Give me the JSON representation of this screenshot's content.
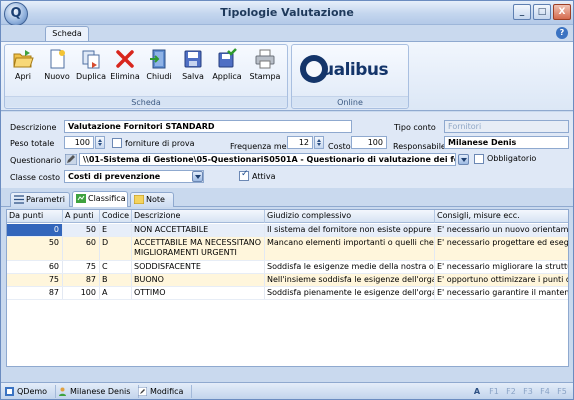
{
  "window": {
    "title": "Tipologie Valutazione",
    "minimize": "_",
    "maximize": "□",
    "close": "X"
  },
  "ribbon": {
    "tab": "Scheda",
    "help": "?",
    "groups": {
      "scheda": "Scheda",
      "online": "Online"
    },
    "buttons": [
      "Apri",
      "Nuovo",
      "Duplica",
      "Elimina",
      "Chiudi",
      "Salva",
      "Applica",
      "Stampa"
    ],
    "logo_text": "ualibus"
  },
  "form": {
    "descrizione_label": "Descrizione",
    "descrizione_value": "Valutazione Fornitori STANDARD",
    "tipo_conto_label": "Tipo conto",
    "tipo_conto_value": "Fornitori",
    "peso_totale_label": "Peso totale",
    "peso_totale_value": "100",
    "forniture_prova_label": "forniture di prova",
    "frequenza_label": "Frequenza mesi",
    "frequenza_value": "12",
    "costo_label": "Costo",
    "costo_value": "100",
    "responsabile_label": "Responsabile",
    "responsabile_value": "Milanese Denis",
    "questionario_label": "Questionario",
    "questionario_value": "\\\\01-Sistema di Gestione\\05-QuestionariS0501A - Questionario di valutazione dei fornit",
    "obbligatorio_label": "Obbligatorio",
    "classe_costo_label": "Classe costo",
    "classe_costo_value": "Costi di prevenzione",
    "attiva_label": "Attiva"
  },
  "tabs": [
    "Parametri",
    "Classifica",
    "Note"
  ],
  "grid": {
    "columns": [
      "Da punti",
      "A punti",
      "Codice",
      "Descrizione",
      "Giudizio complessivo",
      "Consigli, misure ecc."
    ],
    "rows": [
      [
        "0",
        "50",
        "E",
        "NON ACCETTABILE",
        "Il sistema del fornitore non esiste oppure è carat",
        "E' necessario un nuovo orientamento"
      ],
      [
        "50",
        "60",
        "D",
        "ACCETTABILE MA NECESSITANO MIGLIORAMENTI URGENTI",
        "Mancano elementi importanti o quelli che ci sono",
        "E' necessario progettare ed eseguire"
      ],
      [
        "60",
        "75",
        "C",
        "SODDISFACENTE",
        "Soddisfa le esigenze medie della nostra organizza",
        "E' necessario migliorare la struttura de"
      ],
      [
        "75",
        "87",
        "B",
        "BUONO",
        "Nell'insieme soddisfa le esigenze dell'organizzazi",
        "E' opportuno ottimizzare i punti debol"
      ],
      [
        "87",
        "100",
        "A",
        "OTTIMO",
        "Soddisfa pienamente le esigenze dell'organizza",
        "E' necessario garantire il mantenimen"
      ]
    ]
  },
  "statusbar": {
    "items": [
      "QDemo",
      "Milanese Denis",
      "Modifica"
    ],
    "fkeys": [
      "A",
      "F1",
      "F2",
      "F3",
      "F4",
      "F5"
    ]
  }
}
